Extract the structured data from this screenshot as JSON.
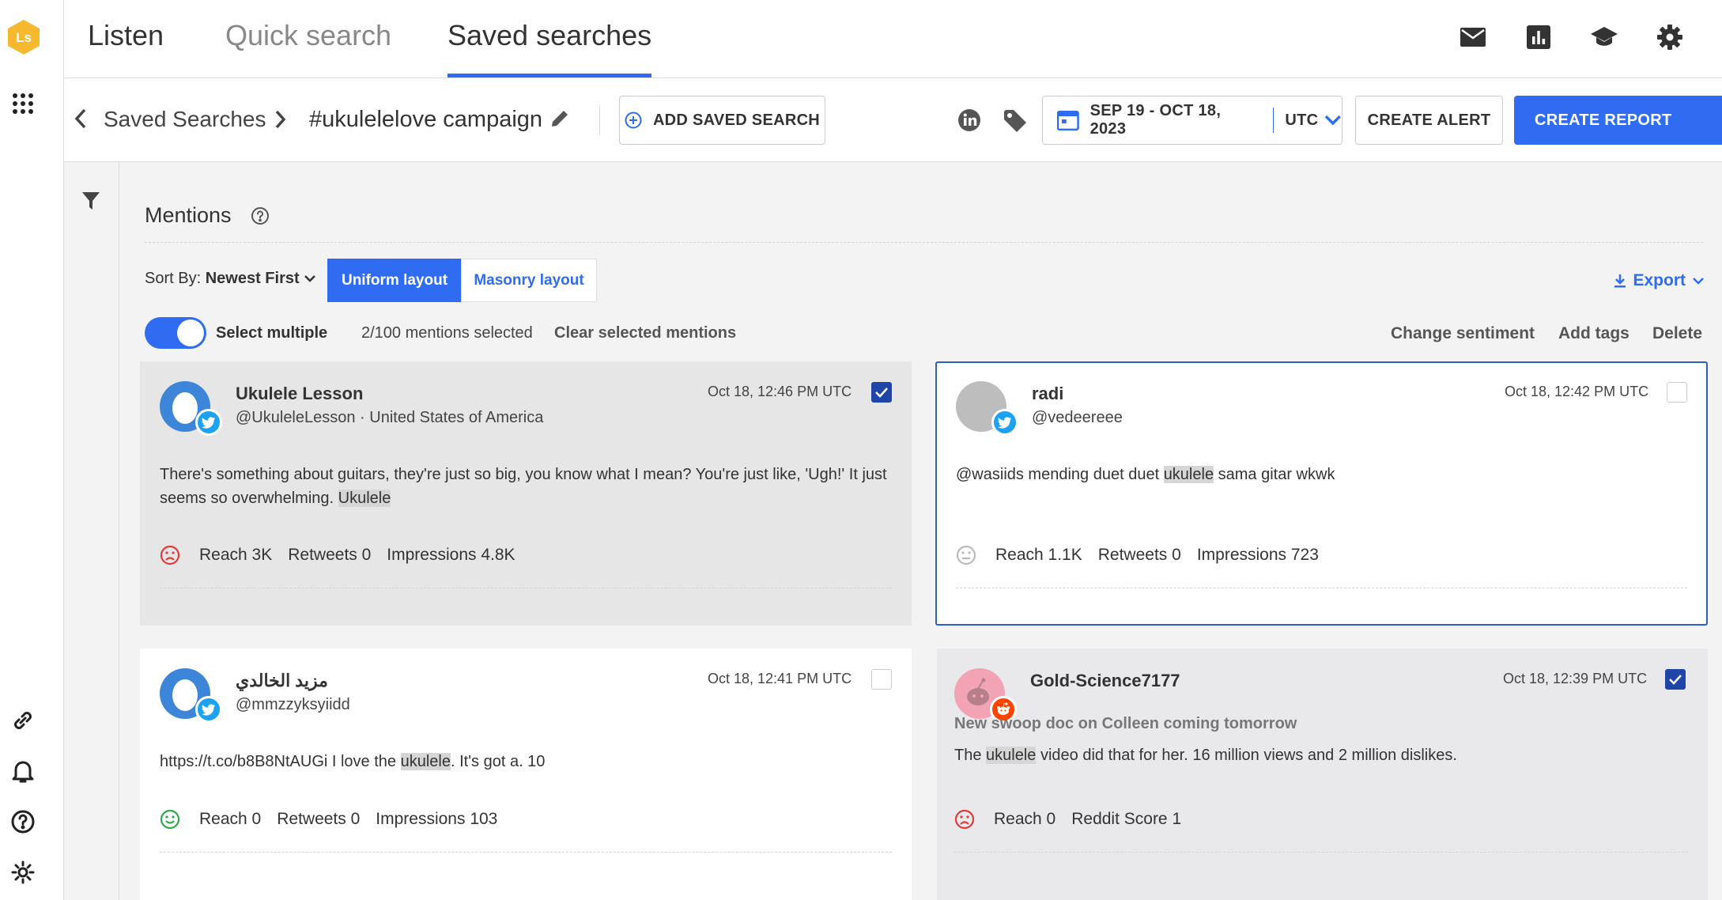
{
  "app": {
    "logo_text": "Ls"
  },
  "nav": {
    "tabs": [
      {
        "label": "Listen"
      },
      {
        "label": "Quick search"
      },
      {
        "label": "Saved searches"
      }
    ]
  },
  "breadcrumb": {
    "root": "Saved Searches",
    "current": "#ukulelelove campaign"
  },
  "toolbar": {
    "add_saved_search": "ADD SAVED SEARCH",
    "date_range": "SEP 19 - OCT 18, 2023",
    "timezone": "UTC",
    "create_alert": "CREATE ALERT",
    "create_report": "CREATE REPORT"
  },
  "mentions": {
    "title": "Mentions",
    "sort_label": "Sort By:",
    "sort_value": "Newest First",
    "layout_uniform": "Uniform layout",
    "layout_masonry": "Masonry layout",
    "export": "Export",
    "select_multiple": "Select multiple",
    "selected_count": "2/100 mentions selected",
    "clear_selected": "Clear selected mentions",
    "actions": [
      "Change sentiment",
      "Add tags",
      "Delete"
    ]
  },
  "cards": [
    {
      "author": "Ukulele Lesson",
      "handle": "@UkuleleLesson · United States of America",
      "timestamp": "Oct 18, 12:46 PM UTC",
      "body_pre": "There's something about guitars, they're just so big, you know what I mean? You're just like, 'Ugh!' It just seems so overwhelming. ",
      "body_hl": "Ukulele",
      "body_post": "",
      "metrics": [
        "Reach 3K",
        "Retweets 0",
        "Impressions 4.8K"
      ],
      "sentiment": "negative",
      "source": "twitter",
      "checked": true
    },
    {
      "author": "radi",
      "handle": "@vedeereee",
      "timestamp": "Oct 18, 12:42 PM UTC",
      "body_pre": "@wasiids mending duet duet ",
      "body_hl": "ukulele",
      "body_post": " sama gitar wkwk",
      "metrics": [
        "Reach 1.1K",
        "Retweets 0",
        "Impressions 723"
      ],
      "sentiment": "neutral",
      "source": "twitter",
      "checked": false
    },
    {
      "author": "مزيد الخالدي",
      "handle": "@mmzzyksyiidd",
      "timestamp": "Oct 18, 12:41 PM UTC",
      "body_pre": "https://t.co/b8B8NtAUGi I love the ",
      "body_hl": "ukulele",
      "body_post": ". It's got a. 10",
      "metrics": [
        "Reach 0",
        "Retweets 0",
        "Impressions 103"
      ],
      "sentiment": "positive",
      "source": "twitter",
      "checked": false
    },
    {
      "author": "Gold-Science7177",
      "subhead": "New swoop doc on Colleen coming tomorrow",
      "timestamp": "Oct 18, 12:39 PM UTC",
      "body_pre": "The ",
      "body_hl": "ukulele",
      "body_post": " video did that for her. 16 million views and 2 million dislikes.",
      "metrics": [
        "Reach 0",
        "Reddit Score 1"
      ],
      "sentiment": "negative",
      "source": "reddit",
      "checked": true
    }
  ],
  "colors": {
    "accent": "#2f6cf2",
    "negative": "#e03a3a",
    "positive": "#2ea84a",
    "neutral": "#bbbbbb"
  }
}
